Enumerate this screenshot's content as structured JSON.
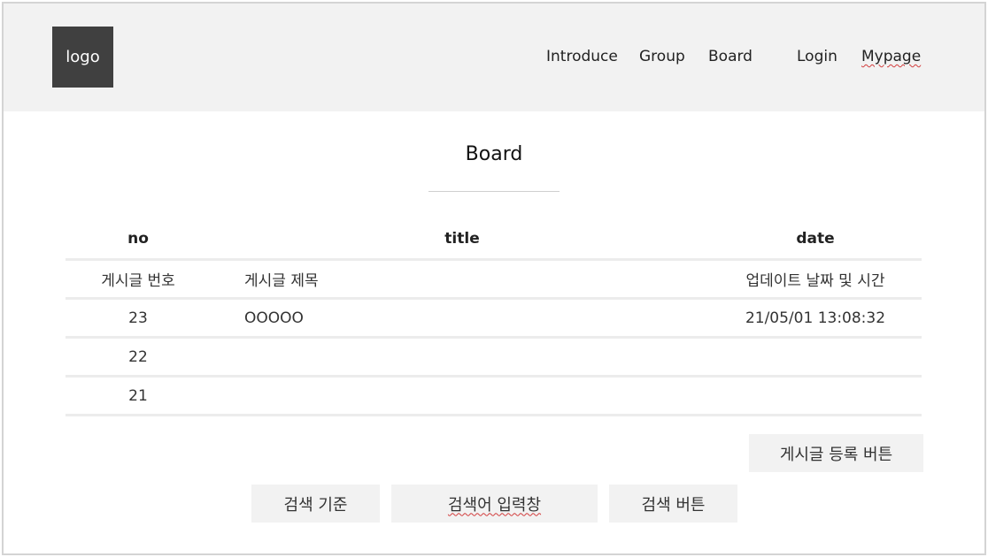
{
  "header": {
    "logo": "logo",
    "nav": [
      {
        "label": "Introduce"
      },
      {
        "label": "Group"
      },
      {
        "label": "Board"
      },
      {
        "label": "Login"
      },
      {
        "label": "Mypage"
      }
    ]
  },
  "main": {
    "title": "Board",
    "table": {
      "columns": {
        "no": "no",
        "title": "title",
        "date": "date"
      },
      "rows": [
        {
          "no": "게시글 번호",
          "title": "게시글 제목",
          "date": "업데이트 날짜 및 시간"
        },
        {
          "no": "23",
          "title": "OOOOO",
          "date": "21/05/01 13:08:32"
        },
        {
          "no": "22",
          "title": "",
          "date": ""
        },
        {
          "no": "21",
          "title": "",
          "date": ""
        }
      ]
    },
    "register_button": "게시글 등록 버튼",
    "search": {
      "criteria_label": "검색 기준",
      "input_label": "검색어 입력창",
      "button_label": "검색 버튼"
    }
  }
}
